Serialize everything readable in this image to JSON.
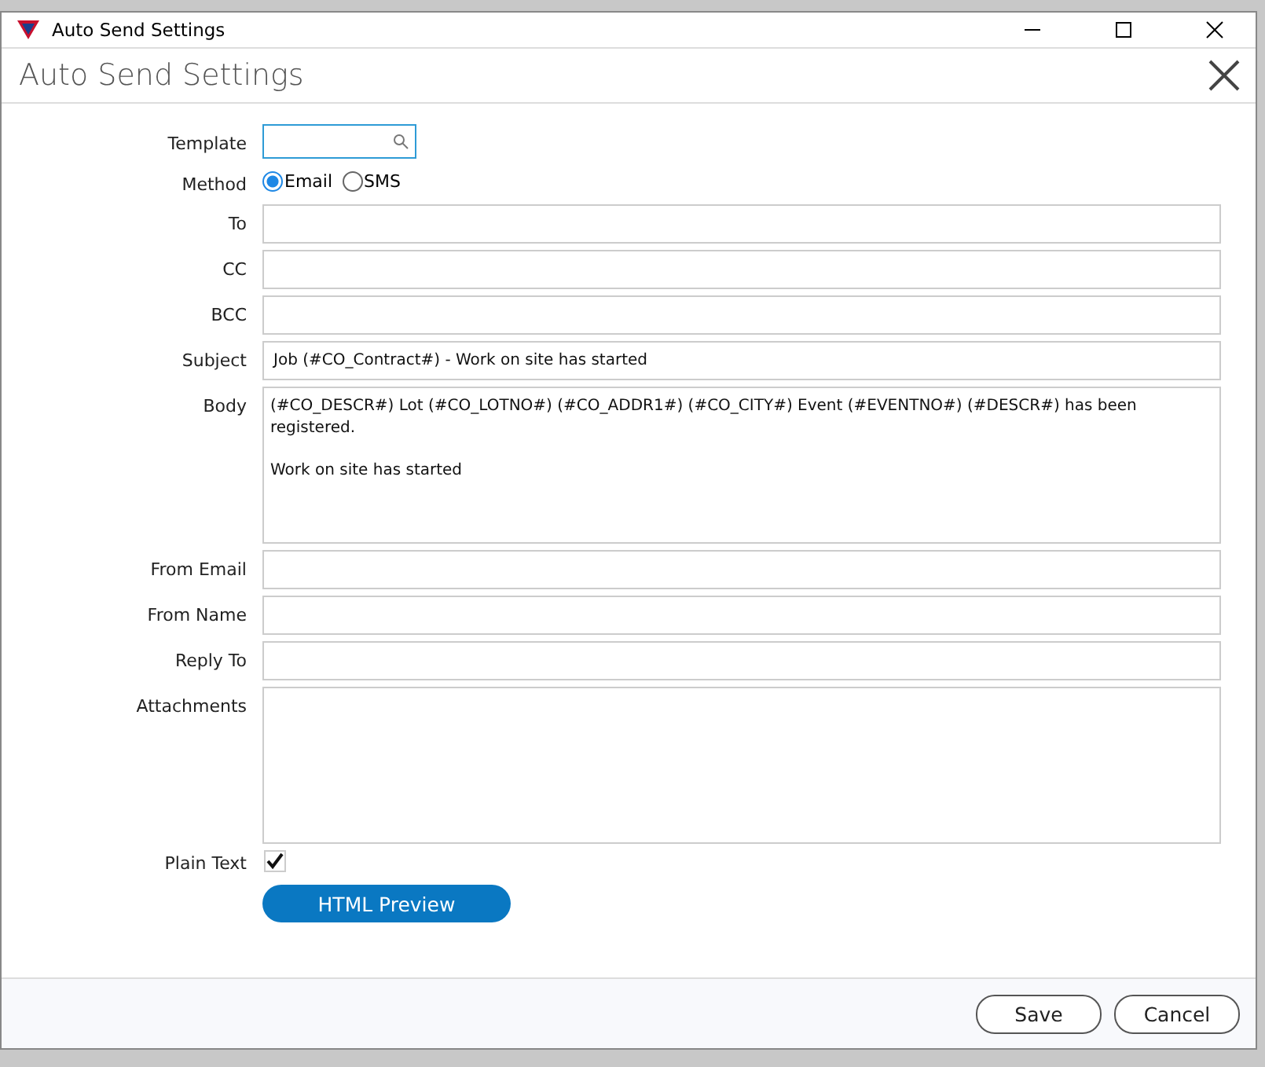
{
  "window": {
    "title": "Auto Send Settings"
  },
  "header": {
    "title": "Auto Send Settings"
  },
  "fields": [
    {
      "kind": "search",
      "label": "Template"
    },
    {
      "kind": "radio",
      "label": "Method",
      "options": [
        {
          "label": "Email",
          "selected": true
        },
        {
          "label": "SMS",
          "selected": false
        }
      ]
    },
    {
      "kind": "text",
      "label": "To"
    },
    {
      "kind": "text",
      "label": "CC"
    },
    {
      "kind": "text",
      "label": "BCC"
    },
    {
      "kind": "text",
      "label": "Subject",
      "value": "Job (#CO_Contract#) - Work on site has started"
    },
    {
      "kind": "textarea",
      "label": "Body",
      "value": "(#CO_DESCR#) Lot (#CO_LOTNO#) (#CO_ADDR1#) (#CO_CITY#) Event (#EVENTNO#) (#DESCR#) has been registered.\n\nWork on site has started"
    },
    {
      "kind": "text",
      "label": "From Email"
    },
    {
      "kind": "text",
      "label": "From Name"
    },
    {
      "kind": "text",
      "label": "Reply To"
    },
    {
      "kind": "textarea",
      "label": "Attachments"
    },
    {
      "kind": "checkbox",
      "label": "Plain Text",
      "checked": true
    }
  ],
  "preview_button": "HTML Preview",
  "buttons": [
    "Save",
    "Cancel"
  ]
}
